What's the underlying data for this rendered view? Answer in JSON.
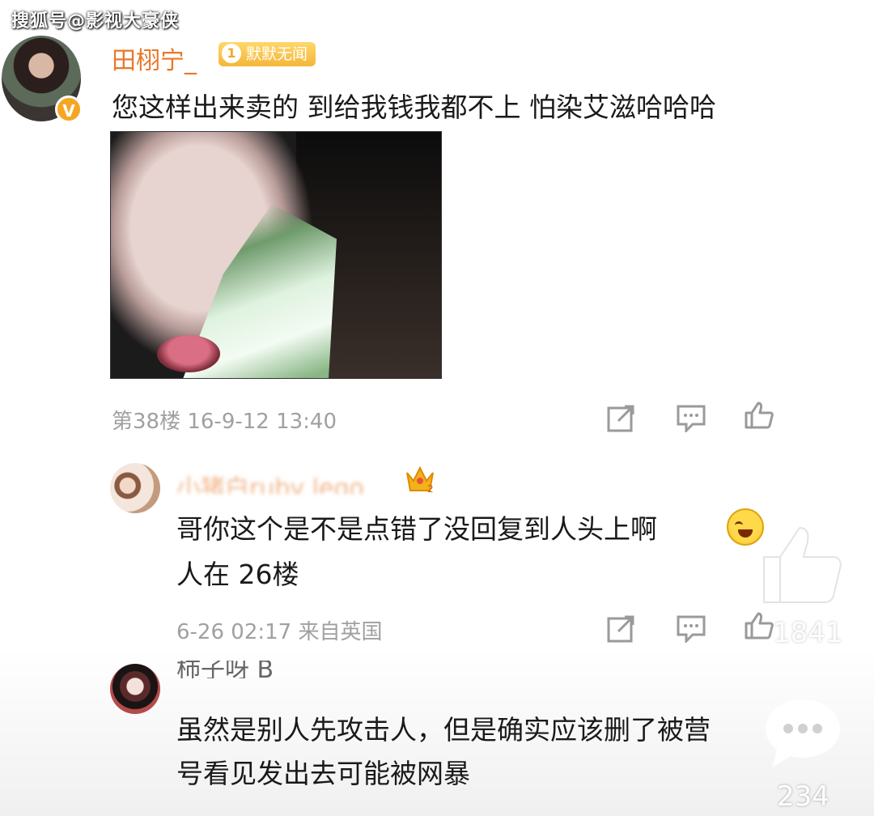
{
  "watermark": "搜狐号@影视大豪侠",
  "post": {
    "username": "田栩宁_",
    "level_num": "1",
    "level_label": "默默无闻",
    "verified_mark": "V",
    "text": "您这样出来卖的 到给我钱我都不上 怕染艾滋哈哈哈",
    "meta": "第38楼 16-9-12 13:40"
  },
  "replies": [
    {
      "name_blurred": "小猪白ruby lego",
      "text_line1": "哥你这个是不是点错了没回复到人头上啊",
      "text_line2": "人在 26楼",
      "meta": "6-26 02:17 来自英国"
    },
    {
      "name_partial": "柿子呀 B",
      "text_line1": "虽然是别人先攻击人，但是确实应该删了被营",
      "text_line2": "号看见发出去可能被网暴"
    }
  ],
  "overlay": {
    "like_count": "1841",
    "comment_count": "234"
  },
  "icons": [
    "share-icon",
    "comment-icon",
    "like-icon",
    "crown-icon",
    "laugh-cry-emoji"
  ]
}
